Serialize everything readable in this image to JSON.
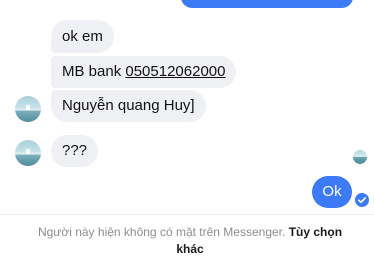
{
  "messages": {
    "received": [
      {
        "text": "ok em"
      },
      {
        "prefix": "MB bank ",
        "account": "050512062000"
      },
      {
        "text": "Nguyễn quang Huy]"
      },
      {
        "text": "???"
      }
    ],
    "sent": {
      "text": "Ok"
    }
  },
  "footer": {
    "notice": "Người này hiện không có mặt trên Messenger.",
    "link": "Tùy chọn khác"
  },
  "colors": {
    "sent_bubble": "#3d7bf6",
    "received_bubble": "#eef0f3"
  }
}
